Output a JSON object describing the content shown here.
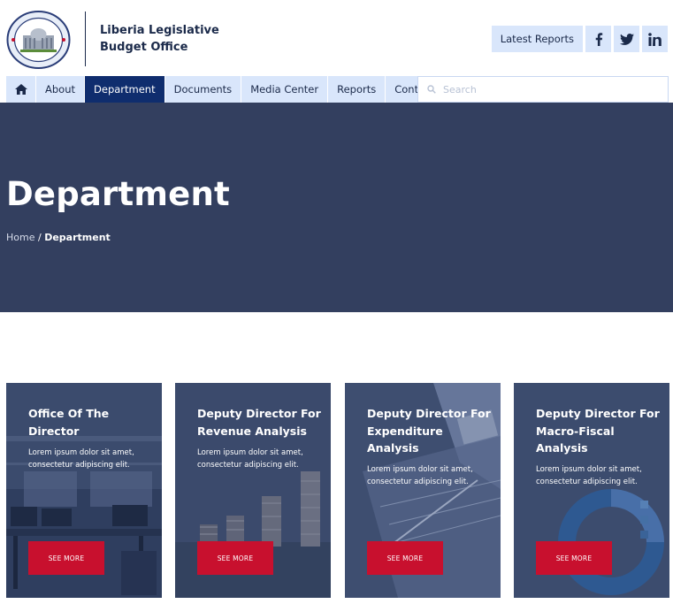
{
  "header": {
    "org_name": "Liberia Legislative Budget Office",
    "latest_reports": "Latest Reports",
    "social": [
      {
        "icon": "facebook-icon"
      },
      {
        "icon": "twitter-icon"
      },
      {
        "icon": "linkedin-icon"
      }
    ]
  },
  "nav": {
    "items": [
      {
        "label": "About"
      },
      {
        "label": "Department",
        "active": true
      },
      {
        "label": "Documents"
      },
      {
        "label": "Media Center"
      },
      {
        "label": "Reports"
      },
      {
        "label": "Contact"
      }
    ],
    "search_placeholder": "Search"
  },
  "hero": {
    "title": "Department",
    "breadcrumb": {
      "home": "Home",
      "separator": "/",
      "current": "Department"
    }
  },
  "cards": [
    {
      "title": "Office Of The Director",
      "desc": "Lorem ipsum dolor sit amet, consectetur adipiscing elit.",
      "button": "SEE MORE"
    },
    {
      "title": "Deputy Director For Revenue Analysis",
      "desc": "Lorem ipsum dolor sit amet, consectetur adipiscing elit.",
      "button": "SEE MORE"
    },
    {
      "title": "Deputy Director For Expenditure Analysis",
      "desc": "Lorem ipsum dolor sit amet, consectetur adipiscing elit.",
      "button": "SEE MORE"
    },
    {
      "title": "Deputy Director For Macro-Fiscal Analysis",
      "desc": "Lorem ipsum dolor sit amet, consectetur adipiscing elit.",
      "button": "SEE MORE"
    }
  ],
  "colors": {
    "navy": "#1b2a4a",
    "nav_bg": "#d9e6fb",
    "active": "#0f2d6e",
    "hero": "#333f5f",
    "button": "#c8102e"
  }
}
